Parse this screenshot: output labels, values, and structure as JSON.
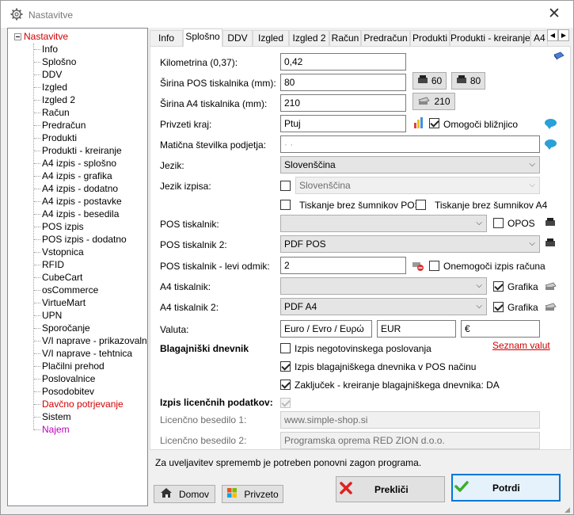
{
  "window": {
    "title": "Nastavitve",
    "close_glyph": "✕"
  },
  "tree": {
    "root": "Nastavitve",
    "items": [
      {
        "label": "Info",
        "color": "#000000"
      },
      {
        "label": "Splošno",
        "color": "#000000"
      },
      {
        "label": "DDV",
        "color": "#000000"
      },
      {
        "label": "Izgled",
        "color": "#000000"
      },
      {
        "label": "Izgled 2",
        "color": "#000000"
      },
      {
        "label": "Račun",
        "color": "#000000"
      },
      {
        "label": "Predračun",
        "color": "#000000"
      },
      {
        "label": "Produkti",
        "color": "#000000"
      },
      {
        "label": "Produkti - kreiranje",
        "color": "#000000"
      },
      {
        "label": "A4 izpis - splošno",
        "color": "#000000"
      },
      {
        "label": "A4 izpis - grafika",
        "color": "#000000"
      },
      {
        "label": "A4 izpis - dodatno",
        "color": "#000000"
      },
      {
        "label": "A4 izpis - postavke",
        "color": "#000000"
      },
      {
        "label": "A4 izpis - besedila",
        "color": "#000000"
      },
      {
        "label": "POS izpis",
        "color": "#000000"
      },
      {
        "label": "POS izpis - dodatno",
        "color": "#000000"
      },
      {
        "label": "Vstopnica",
        "color": "#000000"
      },
      {
        "label": "RFID",
        "color": "#000000"
      },
      {
        "label": "CubeCart",
        "color": "#000000"
      },
      {
        "label": "osCommerce",
        "color": "#000000"
      },
      {
        "label": "VirtueMart",
        "color": "#000000"
      },
      {
        "label": "UPN",
        "color": "#000000"
      },
      {
        "label": "Sporočanje",
        "color": "#000000"
      },
      {
        "label": "V/I naprave - prikazovalnik",
        "color": "#000000"
      },
      {
        "label": "V/I naprave - tehtnica",
        "color": "#000000"
      },
      {
        "label": "Plačilni prehod",
        "color": "#000000"
      },
      {
        "label": "Poslovalnice",
        "color": "#000000"
      },
      {
        "label": "Posodobitev",
        "color": "#000000"
      },
      {
        "label": "Davčno potrjevanje",
        "color": "#d00000"
      },
      {
        "label": "Sistem",
        "color": "#000000"
      },
      {
        "label": "Najem",
        "color": "#c000c0"
      }
    ]
  },
  "tabs": [
    "Info",
    "Splošno",
    "DDV",
    "Izgled",
    "Izgled 2",
    "Račun",
    "Predračun",
    "Produkti",
    "Produkti - kreiranje",
    "A4"
  ],
  "active_tab": "Splošno",
  "form": {
    "kilometrina": {
      "label": "Kilometrina (0,37):",
      "value": "0,42"
    },
    "sirina_pos": {
      "label": "Širina POS tiskalnika (mm):",
      "value": "80",
      "btn1": "60",
      "btn2": "80"
    },
    "sirina_a4": {
      "label": "Širina A4 tiskalnika (mm):",
      "value": "210",
      "btn": "210"
    },
    "privzeti_kraj": {
      "label": "Privzeti kraj:",
      "value": "Ptuj",
      "check_label": "Omogoči bližnjico"
    },
    "maticna": {
      "label": "Matična številka podjetja:",
      "value": "·   ·"
    },
    "jezik": {
      "label": "Jezik:",
      "value": "Slovenščina"
    },
    "jezik_izpisa": {
      "label": "Jezik izpisa:",
      "value": "Slovenščina"
    },
    "tiskanje_pos": "Tiskanje brez šumnikov POS",
    "tiskanje_a4": "Tiskanje brez šumnikov A4",
    "pos_tiskalnik": {
      "label": "POS tiskalnik:",
      "value": "",
      "check_label": "OPOS"
    },
    "pos_tiskalnik2": {
      "label": "POS tiskalnik 2:",
      "value": "PDF POS"
    },
    "pos_odmik": {
      "label": "POS tiskalnik - levi odmik:",
      "value": "2",
      "check_label": "Onemogoči izpis računa"
    },
    "a4_tiskalnik": {
      "label": "A4 tiskalnik:",
      "value": "",
      "check_label": "Grafika"
    },
    "a4_tiskalnik2": {
      "label": "A4 tiskalnik 2:",
      "value": "PDF A4",
      "check_label": "Grafika"
    },
    "valuta": {
      "label": "Valuta:",
      "v1": "Euro / Evro / Ευρώ",
      "v2": "EUR",
      "v3": "€"
    },
    "blagajniski": {
      "label": "Blagajniški dnevnik",
      "c1": "Izpis negotovinskega poslovanja",
      "c2": "Izpis blagajniškega dnevnika v POS načinu",
      "c3": "Zaključek - kreiranje blagajniškega dnevnika: DA",
      "link": "Seznam valut"
    },
    "licencni": {
      "label": "Izpis licenčnih podatkov:",
      "b1_label": "Licenčno besedilo 1:",
      "b1": "www.simple-shop.si",
      "b2_label": "Licenčno besedilo 2:",
      "b2": "Programska oprema RED ZION d.o.o."
    }
  },
  "note": "Za uveljavitev sprememb je potreben ponovni zagon programa.",
  "buttons": {
    "domov": "Domov",
    "privzeto": "Privzeto",
    "preklici": "Prekliči",
    "potrdi": "Potrdi"
  }
}
